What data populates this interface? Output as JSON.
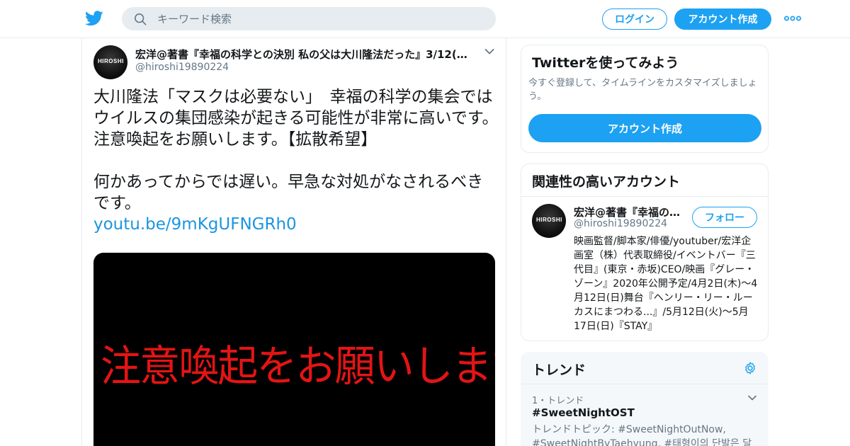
{
  "header": {
    "search_placeholder": "キーワード検索",
    "login_label": "ログイン",
    "signup_label": "アカウント作成",
    "brand_color": "#1da1f2"
  },
  "tweet": {
    "author_name": "宏洋@著書『幸福の科学との決別 私の父は大川隆法だった』3/12(木…",
    "author_handle": "@hiroshi19890224",
    "avatar_text": "HIROSHI",
    "text": "大川隆法「マスクは必要ない」　幸福の科学の集会ではウイルスの集団感染が起きる可能性が非常に高いです。注意喚起をお願いします。【拡散希望】\n\n何かあってからでは遅い。早急な対処がなされるべきです。",
    "link": "youtu.be/9mKgUFNGRh0",
    "media_caption": "注意喚起をお願いします",
    "media_caption_color": "#e41414"
  },
  "try_card": {
    "title": "Twitterを使ってみよう",
    "description": "今すぐ登録して、タイムラインをカスタマイズしましょう。",
    "button_label": "アカウント作成"
  },
  "related": {
    "title": "関連性の高いアカウント",
    "account": {
      "name": "宏洋@著書『幸福の…",
      "handle": "@hiroshi19890224",
      "avatar_text": "HIROSHI",
      "follow_label": "フォロー",
      "bio": "映画監督/脚本家/俳優/youtuber/宏洋企画室（株）代表取締役/イベントバー『三代目』(東京・赤坂)CEO/映画『グレー・ゾーン』2020年公開予定/4月2日(木)〜4月12日(日)舞台『ヘンリー・リー・ルーカスにまつわる...』/5月12日(火)〜5月17日(日)『STAY』"
    }
  },
  "trends": {
    "title": "トレンド",
    "items": [
      {
        "rank_label": "1・トレンド",
        "tag": "#SweetNightOST",
        "topics": "トレンドトピック: #SweetNightOutNow, #SweetNightByTaehyung, #태형이의 단발은 달"
      }
    ]
  }
}
